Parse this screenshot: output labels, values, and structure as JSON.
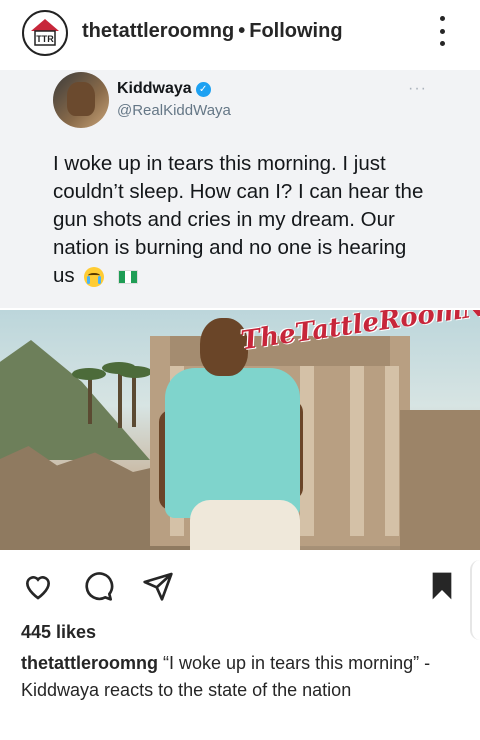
{
  "header": {
    "username": "thetattleroomng",
    "separator": "•",
    "follow_status": "Following",
    "avatar_label": "TTR"
  },
  "tweet": {
    "name": "Kiddwaya",
    "handle": "@RealKiddWaya",
    "menu": "···",
    "text": "I woke up in tears this morning. I just couldn’t sleep. How can I? I can hear the gun shots and cries in my dream. Our nation is burning and no one is hearing us",
    "emoji_icons": [
      "crying-face-icon",
      "nigeria-flag-icon"
    ]
  },
  "photo": {
    "watermark": "TheTattleRoomNg"
  },
  "post": {
    "likes": "445 likes",
    "caption_user": "thetattleroomng",
    "caption_text": "“I woke up in tears this morning” - Kiddwaya reacts to the state of the nation"
  },
  "icons": {
    "like": "heart-icon",
    "comment": "comment-icon",
    "share": "send-icon",
    "save": "bookmark-icon"
  },
  "colors": {
    "text": "#262626",
    "verified": "#1da1f2",
    "watermark": "#c7263a",
    "tweet_bg": "#f2f3f5"
  }
}
